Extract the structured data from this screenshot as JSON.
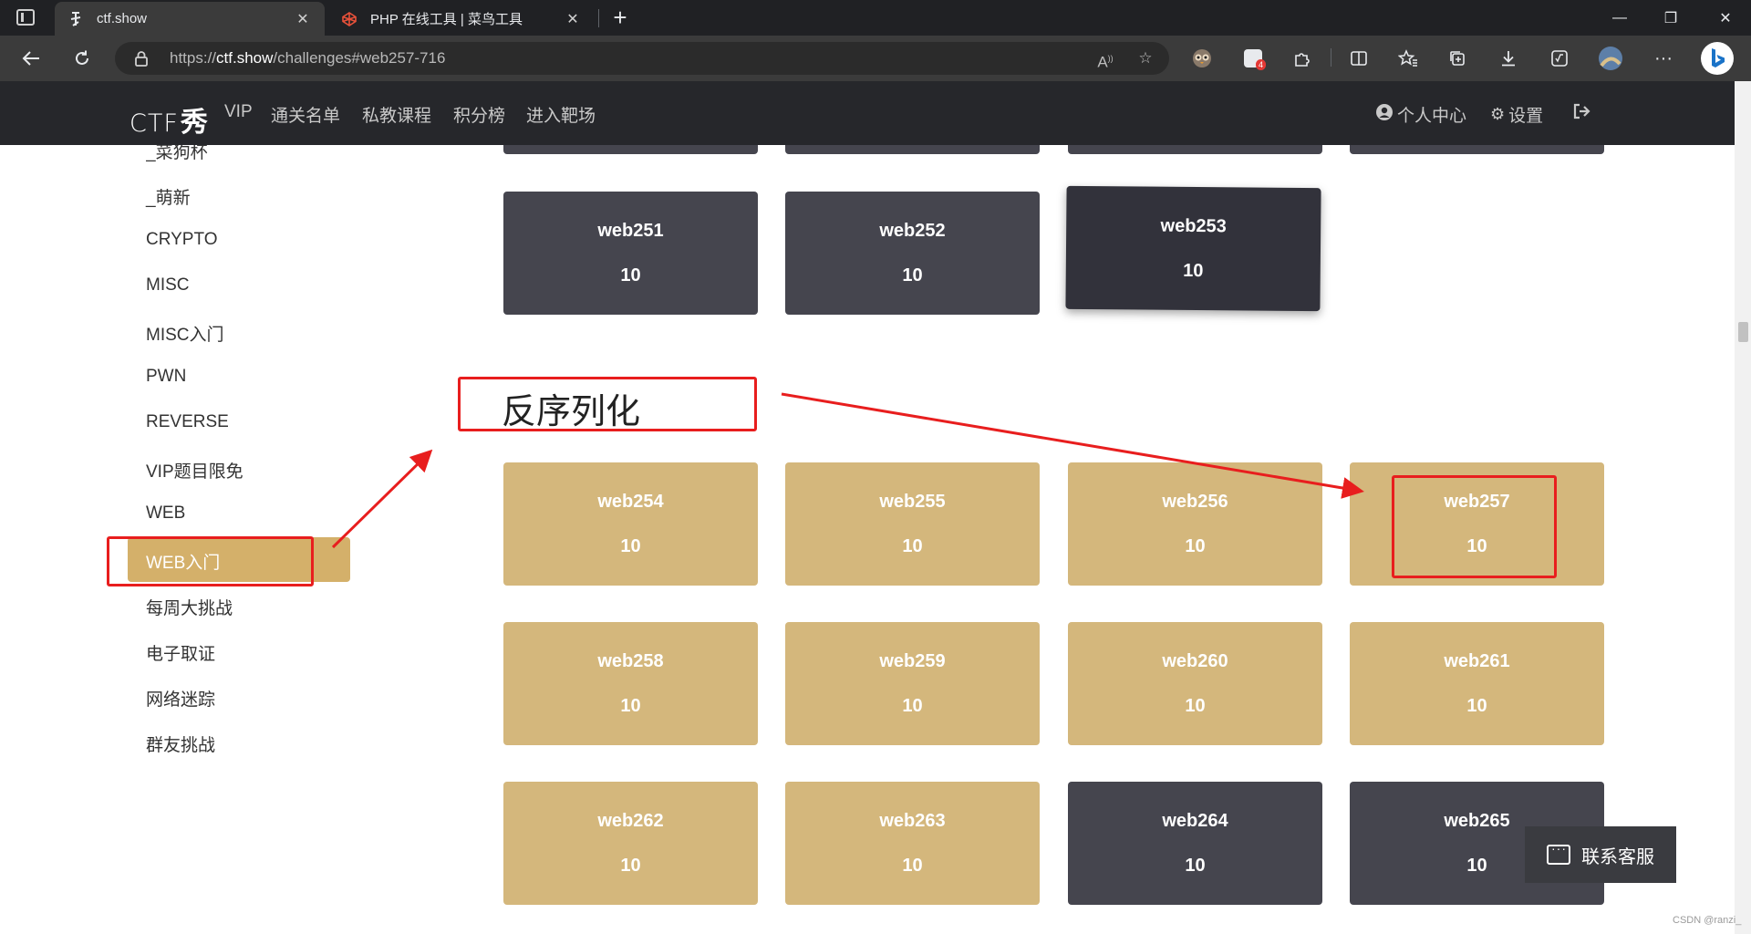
{
  "browser": {
    "tabs": [
      {
        "title": "ctf.show",
        "icon": "ctf-favicon",
        "active": true
      },
      {
        "title": "PHP 在线工具 | 菜鸟工具",
        "icon": "codepen-favicon",
        "active": false
      }
    ],
    "address": {
      "prefix": "https://",
      "host": "ctf.show",
      "path": "/challenges#web257-716"
    },
    "extension_badge": "4",
    "window_controls": {
      "minimize": "—",
      "restore": "❐",
      "close": "✕"
    }
  },
  "site": {
    "logo_text": "CTF",
    "logo_mark": "秀",
    "nav": [
      "VIP",
      "通关名单",
      "私教课程",
      "积分榜",
      "进入靶场"
    ],
    "user_center": "个人中心",
    "settings": "设置"
  },
  "sidebar": {
    "items": [
      "_菜狗杯",
      "_萌新",
      "CRYPTO",
      "MISC",
      "MISC入门",
      "PWN",
      "REVERSE",
      "VIP题目限免",
      "WEB",
      "WEB入门",
      "每周大挑战",
      "电子取证",
      "网络迷踪",
      "群友挑战"
    ],
    "active": "WEB入门"
  },
  "section_title": "反序列化",
  "challenges": {
    "row_top": [
      {
        "name": "web251",
        "score": "10",
        "state": "unsolved"
      },
      {
        "name": "web252",
        "score": "10",
        "state": "unsolved"
      },
      {
        "name": "web253",
        "score": "10",
        "state": "hover"
      }
    ],
    "row1": [
      {
        "name": "web254",
        "score": "10",
        "state": "solved"
      },
      {
        "name": "web255",
        "score": "10",
        "state": "solved"
      },
      {
        "name": "web256",
        "score": "10",
        "state": "solved"
      },
      {
        "name": "web257",
        "score": "10",
        "state": "solved"
      }
    ],
    "row2": [
      {
        "name": "web258",
        "score": "10",
        "state": "solved"
      },
      {
        "name": "web259",
        "score": "10",
        "state": "solved"
      },
      {
        "name": "web260",
        "score": "10",
        "state": "solved"
      },
      {
        "name": "web261",
        "score": "10",
        "state": "solved"
      }
    ],
    "row3": [
      {
        "name": "web262",
        "score": "10",
        "state": "solved"
      },
      {
        "name": "web263",
        "score": "10",
        "state": "solved"
      },
      {
        "name": "web264",
        "score": "10",
        "state": "unsolved"
      },
      {
        "name": "web265",
        "score": "10",
        "state": "unsolved"
      }
    ]
  },
  "support_label": "联系客服",
  "watermark": "CSDN @ranzi_",
  "colors": {
    "solved": "#d4b77c",
    "unsolved": "#45454e",
    "accent": "#d4b06a",
    "annotation": "#e81e1e"
  }
}
